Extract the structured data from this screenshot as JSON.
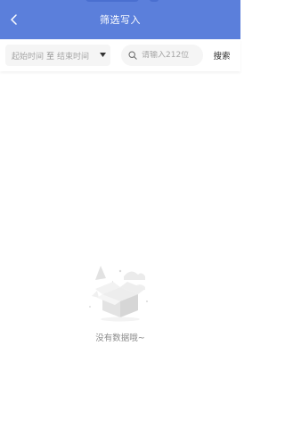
{
  "header": {
    "title": "筛选写入",
    "brand_color": "#5b7fdb"
  },
  "filter": {
    "start_placeholder": "起始时间",
    "separator": "至",
    "end_placeholder": "结束时间",
    "search_placeholder": "请输入212位",
    "search_button": "搜索"
  },
  "empty_state": {
    "message": "没有数据哦~",
    "icon": "empty-box-icon"
  }
}
